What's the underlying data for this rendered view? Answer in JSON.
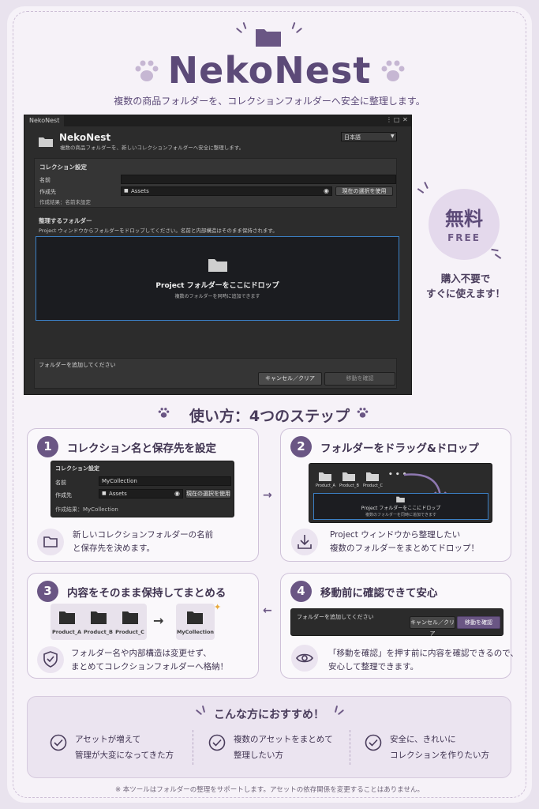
{
  "header": {
    "title": "NekoNest",
    "subtitle": "複数の商品フォルダーを、コレクションフォルダーへ安全に整理します。"
  },
  "window": {
    "tab": "NekoNest",
    "app_title": "NekoNest",
    "app_subtitle": "複数の商品フォルダーを、新しいコレクションフォルダーへ安全に整理します。",
    "language": "日本語",
    "collection_section": "コレクション設定",
    "name_label": "名前",
    "name_value": "",
    "dest_label": "作成先",
    "dest_value": "Assets",
    "use_selection": "現在の選択を使用",
    "result_text": "作成結果：名前未設定",
    "folders_section": "整理するフォルダー",
    "folders_hint": "Project ウィンドウからフォルダーをドロップしてください。名前と内部構造はそのまま保持されます。",
    "drop_title": "Project フォルダーをここにドロップ",
    "drop_sub": "複数のフォルダーを同時に追加できます",
    "status": "フォルダーを追加してください",
    "cancel": "キャンセル／クリア",
    "confirm": "移動を確認"
  },
  "badge": {
    "jp": "無料",
    "en": "FREE",
    "note1": "購入不要で",
    "note2": "すぐに使えます！"
  },
  "steps_title": "使い方：4つのステップ",
  "steps": [
    {
      "num": "1",
      "title": "コレクション名と保存先を設定",
      "mini": {
        "section": "コレクション設定",
        "name_label": "名前",
        "name_value": "MyCollection",
        "dest_label": "作成先",
        "dest_value": "Assets",
        "use_selection": "現在の選択を使用",
        "result": "作成結果：MyCollection"
      },
      "desc1": "新しいコレクションフォルダーの名前",
      "desc2": "と保存先を決めます。"
    },
    {
      "num": "2",
      "title": "フォルダーをドラッグ&ドロップ",
      "mini": {
        "folders": [
          "Product_A",
          "Product_B",
          "Product_C"
        ],
        "more": "• • •",
        "drop_title": "Project フォルダーをここにドロップ",
        "drop_sub": "複数のフォルダーを同時に追加できます"
      },
      "desc1": "Project ウィンドウから整理したい",
      "desc2": "複数のフォルダーをまとめてドロップ！"
    },
    {
      "num": "3",
      "title": "内容をそのまま保持してまとめる",
      "folders": [
        "Product_A",
        "Product_B",
        "Product_C"
      ],
      "result_folder": "MyCollection",
      "desc1": "フォルダー名や内部構造は変更せず、",
      "desc2": "まとめてコレクションフォルダーへ格納！"
    },
    {
      "num": "4",
      "title": "移動前に確認できて安心",
      "mini": {
        "status": "フォルダーを追加してください",
        "cancel": "キャンセル／クリア",
        "confirm": "移動を確認"
      },
      "desc1": "「移動を確認」を押す前に内容を確認できるので、",
      "desc2": "安心して整理できます。"
    }
  ],
  "recommend": {
    "title": "こんな方におすすめ！",
    "items": [
      {
        "line1": "アセットが増えて",
        "line2": "管理が大変になってきた方"
      },
      {
        "line1": "複数のアセットをまとめて",
        "line2": "整理したい方"
      },
      {
        "line1": "安全に、きれいに",
        "line2": "コレクションを作りたい方"
      }
    ]
  },
  "footnote": "※ 本ツールはフォルダーの整理をサポートします。アセットの依存関係を変更することはありません。",
  "colors": {
    "accent": "#6a5684",
    "background": "#f6f2f8",
    "editor": "#2c2c2c",
    "drop_border": "#3b7fc4"
  }
}
